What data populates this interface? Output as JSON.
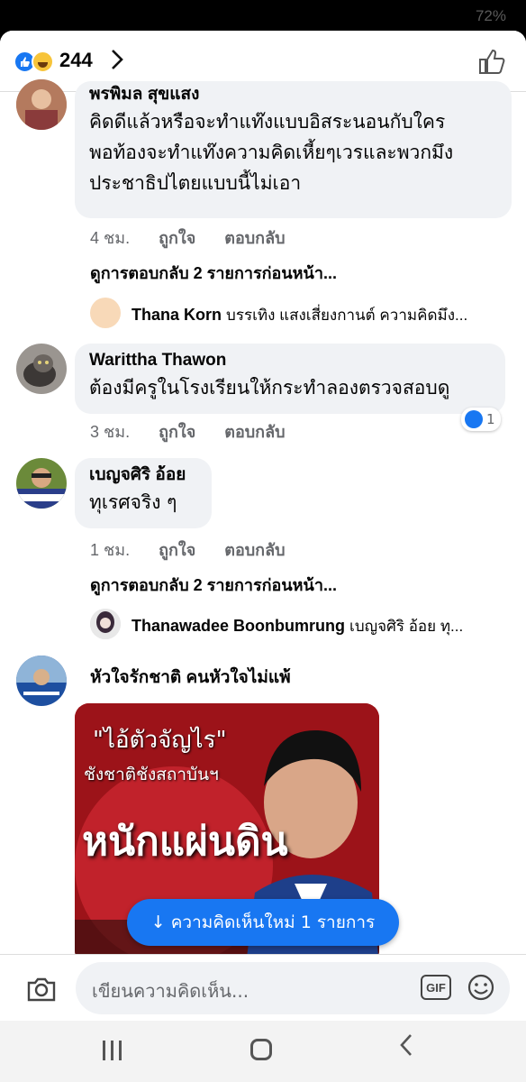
{
  "status_bar": {
    "battery": "72%"
  },
  "header": {
    "reaction_count": "244"
  },
  "comments": [
    {
      "name": "พรพิมล สุขแสง",
      "lines": [
        "คิดดีแล้วหรือจะทำแท๊งแบบอิสระนอนกับใคร",
        "พอท้องจะทำแท๊งความคิดเหี้ยๆเวรและพวกมึง",
        "ประชาธิปไตยแบบนี้ไม่เอา"
      ],
      "time": "4 ชม.",
      "like": "ถูกใจ",
      "reply": "ตอบกลับ",
      "view_more": "ดูการตอบกลับ 2 รายการก่อนหน้า...",
      "reply_preview": {
        "name": "Thana Korn",
        "text": "บรรเทิง แสงเสี่ยงกานต์ ความคิดมึง..."
      }
    },
    {
      "name": "Warittha Thawon",
      "lines": [
        "ต้องมีครูในโรงเรียนให้กระทำลองตรวจสอบดู"
      ],
      "time": "3 ชม.",
      "like": "ถูกใจ",
      "reply": "ตอบกลับ",
      "like_badge": "1"
    },
    {
      "name": "เบญจศิริ อ้อย",
      "lines": [
        "ทุเรศจริง ๆ"
      ],
      "time": "1 ชม.",
      "like": "ถูกใจ",
      "reply": "ตอบกลับ",
      "view_more": "ดูการตอบกลับ 2 รายการก่อนหน้า...",
      "reply_preview": {
        "name": "Thanawadee Boonbumrung",
        "text": "เบญจศิริ อ้อย ทุ..."
      }
    },
    {
      "name": "หัวใจรักชาติ คนหัวใจไม่แพ้",
      "image_text": {
        "line1": "\"ไอ้ตัวจัญไร\"",
        "line2": "ชังชาติชังสถาบันฯ",
        "line3": "หนักแผ่นดิน"
      }
    }
  ],
  "new_comments_pill": "↓ ความคิดเห็นใหม่ 1 รายการ",
  "composer": {
    "placeholder": "เขียนความคิดเห็น...",
    "gif_label": "GIF"
  },
  "colors": {
    "accent": "#1877f2",
    "bubble": "#f0f2f5",
    "meta_text": "#65676b"
  }
}
